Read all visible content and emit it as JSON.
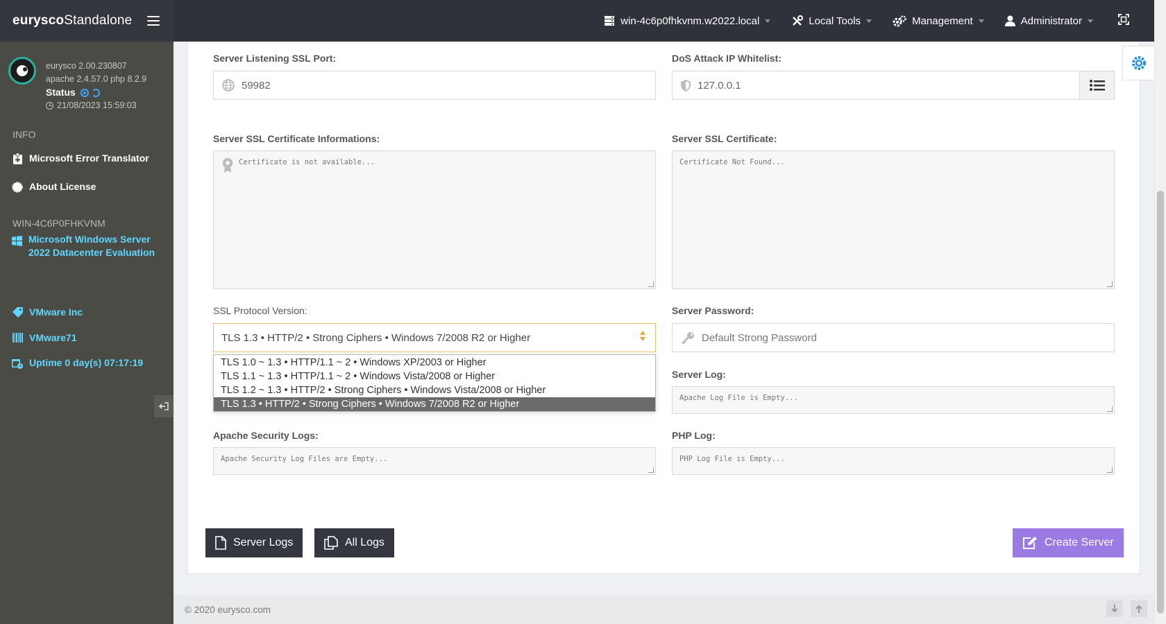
{
  "topbar": {
    "brand_bold": "eurysco",
    "brand_light": "Standalone",
    "host": "win-4c6p0fhkvnm.w2022.local",
    "local_tools": "Local Tools",
    "management": "Management",
    "user": "Administrator"
  },
  "sidebar": {
    "version": "eurysco 2.00.230807",
    "stack": "apache 2.4.57.0  php 8.2.9",
    "status_label": "Status",
    "datetime": "21/08/2023 15:59:03",
    "info_title": "INFO",
    "info_items": [
      {
        "label": "Microsoft Error Translator"
      },
      {
        "label": "About License"
      }
    ],
    "host_title": "WIN-4C6P0FHKVNM",
    "host_items": [
      {
        "label": "Microsoft  Windows  Server 2022  Datacenter  Evaluation"
      },
      {
        "label": "VMware Inc"
      },
      {
        "label": "VMware71"
      },
      {
        "label": "Uptime 0 day(s) 07:17:19"
      }
    ]
  },
  "form": {
    "ssl_port_label": "Server Listening SSL Port:",
    "ssl_port_value": "59982",
    "dos_label": "DoS Attack IP Whitelist:",
    "dos_value": "127.0.0.1",
    "cert_info_label": "Server SSL Certificate Informations:",
    "cert_info_placeholder": "Certificate is not available...",
    "cert_label": "Server SSL Certificate:",
    "cert_placeholder": "Certificate Not Found...",
    "ssl_protocol_label": "SSL Protocol Version:",
    "ssl_protocol_selected": "TLS 1.3 • HTTP/2 • Strong Ciphers • Windows 7/2008 R2 or Higher",
    "ssl_protocol_options": [
      "TLS 1.0 ~ 1.3 • HTTP/1.1 ~ 2 • Windows XP/2003 or Higher",
      "TLS 1.1 ~ 1.3 • HTTP/1.1 ~ 2 • Windows Vista/2008 or Higher",
      "TLS 1.2 ~ 1.3 • HTTP/2 • Strong Ciphers • Windows Vista/2008 or Higher",
      "TLS 1.3 • HTTP/2 • Strong Ciphers • Windows 7/2008 R2 or Higher"
    ],
    "password_label": "Server Password:",
    "password_placeholder": "Default Strong Password",
    "server_log_label": "Server Log:",
    "server_log_placeholder": "Apache Log File is Empty...",
    "security_logs_label": "Apache Security Logs:",
    "security_logs_placeholder": "Apache Security Log Files are Empty...",
    "php_log_label": "PHP Log:",
    "php_log_placeholder": "PHP Log File is Empty..."
  },
  "buttons": {
    "server_logs": "Server Logs",
    "all_logs": "All Logs",
    "create_server": "Create Server"
  },
  "footer": {
    "copyright": "© 2020   eurysco.com"
  },
  "colors": {
    "topbar": "#2f323b",
    "sidebar": "#4a4b45",
    "accent_cyan": "#5fd7ff",
    "create_button": "#9b7ae3",
    "select_border": "#e8c26a"
  }
}
